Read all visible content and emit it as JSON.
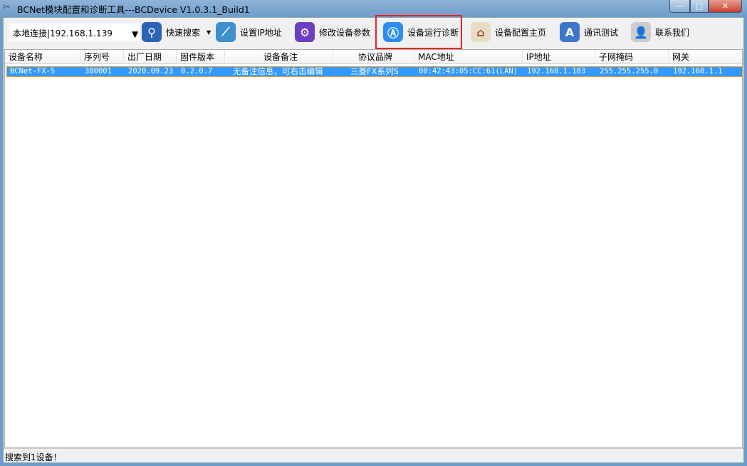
{
  "window": {
    "title": "BCNet模块配置和诊断工具---BCDevice V1.0.3.1_Build1",
    "min": "—",
    "max": "□",
    "close": "✕"
  },
  "toolbar": {
    "connection": "本地连接|192.168.1.139",
    "buttons": [
      {
        "label": "快速搜索",
        "icon": "search-icon",
        "color": "#2b63b8"
      },
      {
        "label": "设置IP地址",
        "icon": "hammer-icon",
        "color": "#3d8fd0"
      },
      {
        "label": "修改设备参数",
        "icon": "gear-icon",
        "color": "#6a3fc2"
      },
      {
        "label": "设备运行诊断",
        "icon": "app-store-icon",
        "color": "#2a8ff0"
      },
      {
        "label": "设备配置主页",
        "icon": "house-icon",
        "color": "#a0522d"
      },
      {
        "label": "通讯测试",
        "icon": "app-store-tools-icon",
        "color": "#3b78c8"
      },
      {
        "label": "联系我们",
        "icon": "contacts-icon",
        "color": "#aaaaaa"
      }
    ],
    "highlighted": "设备运行诊断",
    "highlight_color": "#ee2222"
  },
  "table": {
    "columns": [
      "设备名称",
      "序列号",
      "出厂日期",
      "固件版本",
      "设备备注",
      "协议品牌",
      "MAC地址",
      "IP地址",
      "子网掩码",
      "网关"
    ],
    "rows": [
      [
        "BCNet-FX-S",
        "380001",
        "2020.09.23",
        "0.2.0.7",
        "无备注信息，可右击编辑",
        "三菱FX系列S",
        "00:42:43:05:CC:61(LAN)",
        "192.168.1.183",
        "255.255.255.0",
        "192.168.1.1"
      ]
    ],
    "selected_color": "#3399ff"
  },
  "status": {
    "text": "搜索到1设备！"
  }
}
